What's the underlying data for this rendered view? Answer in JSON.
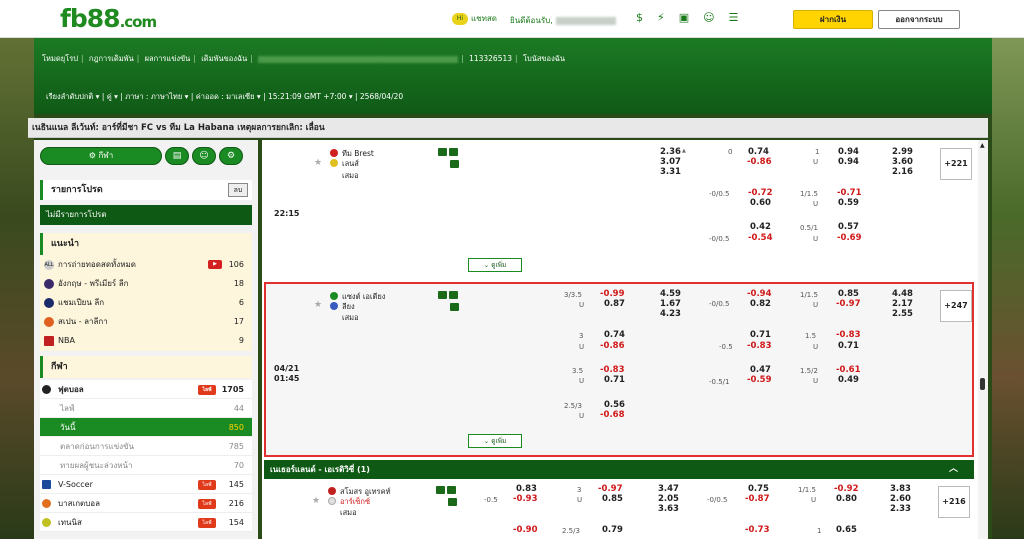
{
  "brand": {
    "logo": "fb88",
    "logo_suffix": ".com",
    "accent": "#1a8a22",
    "yellow": "#ffd400"
  },
  "topbar": {
    "chat": "แชทสด",
    "welcome": "ยินดีต้อนรับ,",
    "deposit": "ฝากเงิน",
    "logout": "ออกจากระบบ",
    "icons": [
      "balance-icon",
      "flash-icon",
      "sports-icon",
      "user-icon",
      "menu-icon"
    ]
  },
  "nav": {
    "links": [
      "โหมดยุโรป",
      "กฎการเดิมพัน",
      "ผลการแข่งขัน",
      "เดิมพันของฉัน",
      "113326513",
      "โบนัสของฉัน"
    ],
    "settings": [
      "เรียงลำดับปกติ",
      "คู่",
      "ภาษา : ภาษาไทย",
      "ค่าออด : มาเลเซีย",
      "15:21:09 GMT +7:00",
      "2568/04/20"
    ]
  },
  "title": "เนธินแนล ลีเว้นท์: อาร์ที่มีชา FC vs ทีม La Habana เหตุผลการยกเลิก: เลื่อน",
  "sidebar": {
    "sports_btn": "กีฬา",
    "fav_title": "รายการโปรด",
    "fav_delete": "ลบ",
    "fav_none": "ไม่มีรายการโปรด",
    "rec_title": "แนะนำ",
    "rec": [
      {
        "name": "การถ่ายทอดสดทั้งหมด",
        "count": "106",
        "live": true
      },
      {
        "name": "อังกฤษ - พรีเมียร์ ลีก",
        "count": "18"
      },
      {
        "name": "แชมเปียน ลีก",
        "count": "6"
      },
      {
        "name": "สเปน - ลาลีกา",
        "count": "17"
      },
      {
        "name": "NBA",
        "count": "9"
      }
    ],
    "sport_title": "กีฬา",
    "sports": [
      {
        "name": "ฟุตบอล",
        "count": "1705",
        "live": "ไลฟ์",
        "main": true
      },
      {
        "name": "ไลฟ์",
        "count": "44",
        "sub": true
      },
      {
        "name": "วันนี้",
        "count": "850",
        "sub": true,
        "active": true
      },
      {
        "name": "ตลาดก่อนการแข่งขัน",
        "count": "785",
        "sub": true
      },
      {
        "name": "ทายผลผู้ชนะล่วงหน้า",
        "count": "70",
        "sub": true
      },
      {
        "name": "V-Soccer",
        "count": "145",
        "live": "ไลฟ์"
      },
      {
        "name": "บาสเกตบอล",
        "count": "216",
        "live": "ไลฟ์"
      },
      {
        "name": "เทนนิส",
        "count": "154",
        "live": "ไลฟ์"
      }
    ]
  },
  "match1": {
    "home": "ทีม Brest",
    "away": "เลนส์",
    "draw": "เสมอ",
    "time": "22:15",
    "more": "+221",
    "expand": "ดูเพิ่ม"
  },
  "match2": {
    "home": "แซงต์ เอเตียง",
    "away": "ลียง",
    "draw": "เสมอ",
    "date": "04/21",
    "time": "01:45",
    "more": "+247",
    "expand": "ดูเพิ่ม"
  },
  "league2": {
    "name": "เนเธอร์แลนด์ - เอเรดิวิซี่ (1)"
  },
  "match3": {
    "home": "สโมสร อูเทรคท์",
    "away": "อาร์เซ็กซ์",
    "draw": "เสมอ",
    "more": "+216"
  }
}
